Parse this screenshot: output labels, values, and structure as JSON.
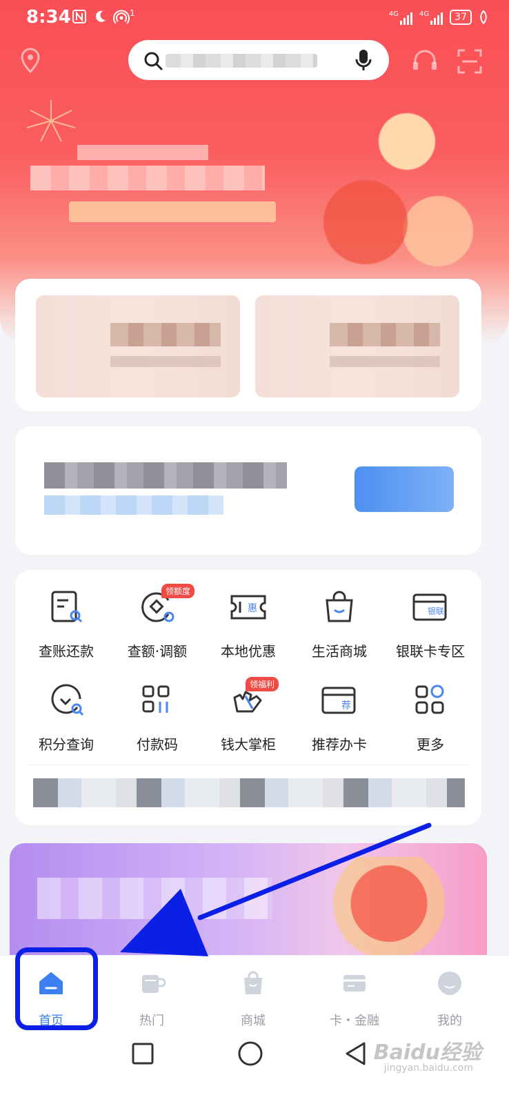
{
  "status_bar": {
    "time": "8:34",
    "left_icons": [
      "nfc-icon",
      "moon-icon",
      "hotspot-icon"
    ],
    "hotspot_count": "1",
    "network_1": "4G",
    "network_2": "4G",
    "battery": "37"
  },
  "header": {
    "left_icon": "location-pin-icon",
    "search_icon": "search-icon",
    "mic_icon": "microphone-icon",
    "right_icons": [
      "customer-service-icon",
      "scan-icon"
    ]
  },
  "menu": {
    "items": [
      {
        "label": "查账还款",
        "icon": "bill-search-icon",
        "tag": ""
      },
      {
        "label": "查额·调额",
        "icon": "quota-adjust-icon",
        "tag": "领额度"
      },
      {
        "label": "本地优惠",
        "icon": "local-coupon-icon",
        "tag": ""
      },
      {
        "label": "生活商城",
        "icon": "shopping-bag-icon",
        "tag": ""
      },
      {
        "label": "银联卡专区",
        "icon": "unionpay-card-icon",
        "tag": ""
      },
      {
        "label": "积分查询",
        "icon": "points-query-icon",
        "tag": ""
      },
      {
        "label": "付款码",
        "icon": "payment-code-icon",
        "tag": ""
      },
      {
        "label": "钱大掌柜",
        "icon": "wealth-manager-icon",
        "tag": "领福利"
      },
      {
        "label": "推荐办卡",
        "icon": "recommend-card-icon",
        "tag": ""
      },
      {
        "label": "更多",
        "icon": "more-grid-icon",
        "tag": ""
      }
    ],
    "icon_glyphs": {
      "local": "惠",
      "unionpay": "银联",
      "recommend": "荐"
    }
  },
  "tabbar": {
    "tabs": [
      {
        "label": "首页",
        "icon": "home-icon",
        "active": true
      },
      {
        "label": "热门",
        "icon": "cup-icon",
        "active": false
      },
      {
        "label": "商城",
        "icon": "bag-icon",
        "active": false
      },
      {
        "label": "卡・金融",
        "icon": "card-icon",
        "active": false
      },
      {
        "label": "我的",
        "icon": "profile-icon",
        "active": false
      }
    ]
  },
  "system_nav": [
    "recents-button",
    "home-button",
    "back-button"
  ],
  "watermark": {
    "text": "Baidu经验",
    "sub": "jingyan.baidu.com"
  },
  "colors": {
    "accent": "#3b7ff3",
    "hero_red": "#fa4e55",
    "annotation_blue": "#0b1fe6",
    "tag_red": "#f04a44"
  }
}
